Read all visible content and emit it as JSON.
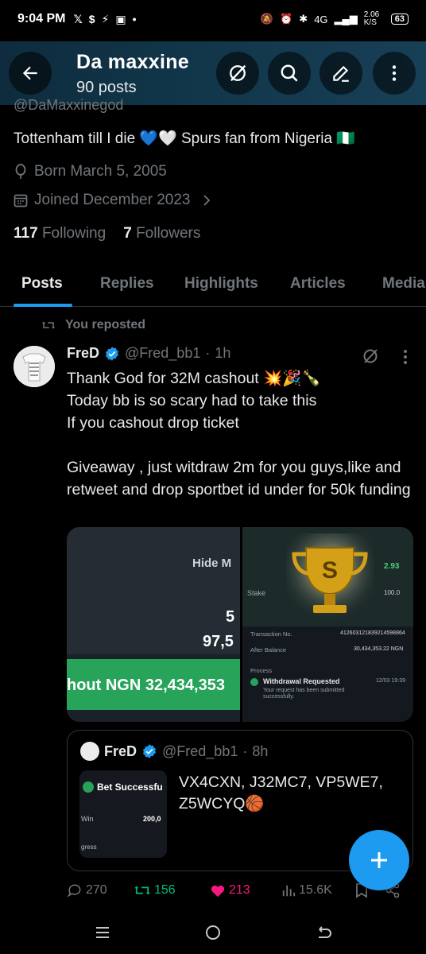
{
  "status_bar": {
    "time": "9:04 PM",
    "notif_icons": [
      "x-logo",
      "dollar",
      "sportybet",
      "app",
      "dot"
    ],
    "network": "4G",
    "speed": "2.06 K/S",
    "battery": "63"
  },
  "header": {
    "title": "Da maxxine",
    "posts_count": "90 posts"
  },
  "profile": {
    "handle_partial": "@DaMaxxinegod",
    "bio": "Tottenham till I die 💙🤍 Spurs fan from Nigeria 🇳🇬",
    "born": "Born March 5, 2005",
    "joined": "Joined December 2023",
    "following_count": "117",
    "following_label": "Following",
    "followers_count": "7",
    "followers_label": "Followers"
  },
  "tabs": [
    {
      "label": "Posts",
      "active": true
    },
    {
      "label": "Replies",
      "active": false
    },
    {
      "label": "Highlights",
      "active": false
    },
    {
      "label": "Articles",
      "active": false
    },
    {
      "label": "Media",
      "active": false
    }
  ],
  "post": {
    "repost_label": "You reposted",
    "author_name": "FreD",
    "author_handle": "@Fred_bb1",
    "time": "1h",
    "text": "Thank God for 32M cashout 💥🎉🍾\nToday bb is so scary had to take this\nIf you cashout drop ticket\n\nGiveaway , just witdraw 2m for you guys,like and retweet and drop sportbet id under for 50k funding",
    "media_left": {
      "hide_label": "Hide M",
      "num1": "5",
      "num2": "97,5",
      "cashout": "hout NGN 32,434,353"
    },
    "media_right": {
      "stake_label": "Stake",
      "odds": "2.93",
      "bet_value": "100.0",
      "transaction_label": "Transaction No.",
      "transaction_no": "412603121839214598864",
      "balance_label": "After Balance",
      "balance_value": "30,434,353.22 NGN",
      "process_label": "Process",
      "withdrawal_title": "Withdrawal Requested",
      "withdrawal_time": "12/03 19:39",
      "withdrawal_desc": "Your request has been submitted successfully."
    },
    "quote": {
      "author_name": "FreD",
      "author_handle": "@Fred_bb1",
      "time": "8h",
      "text": "VX4CXN, J32MC7, VP5WE7, Z5WCYQ🏀",
      "thumb_title": "Bet Successfu",
      "thumb_win_label": "Win",
      "thumb_win_value": "200,0",
      "thumb_progress": "gress"
    },
    "stats": {
      "replies": "270",
      "reposts": "156",
      "likes": "213",
      "views": "15.6K"
    }
  },
  "colors": {
    "accent": "#1d9bf0",
    "repost_green": "#00ba7c",
    "like_pink": "#f91880",
    "muted": "#71767b"
  }
}
